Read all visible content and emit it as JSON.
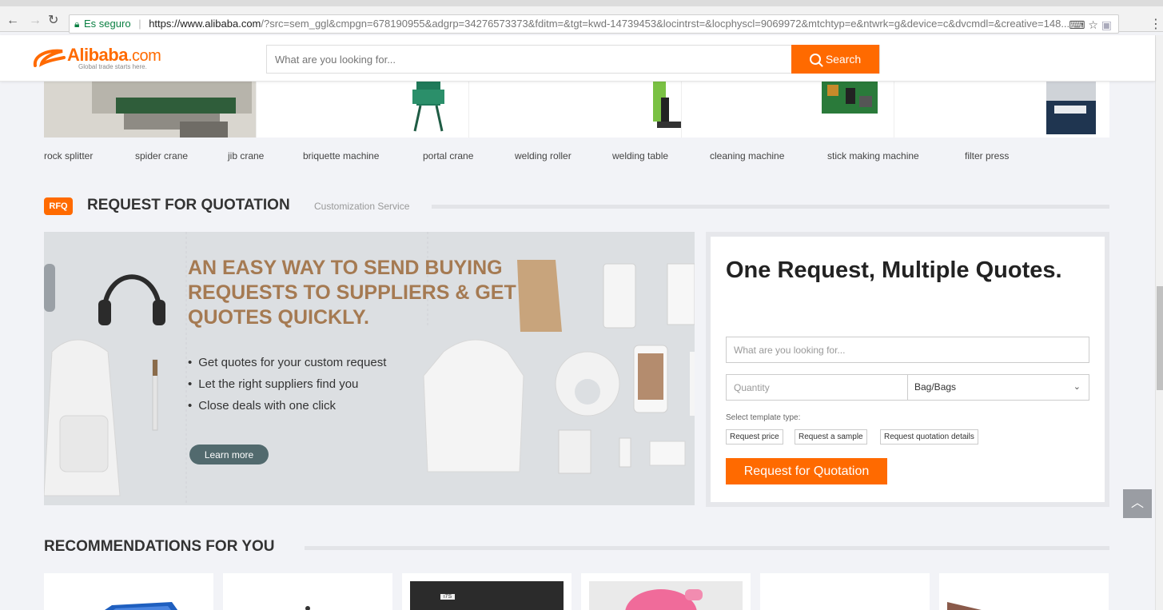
{
  "browser": {
    "secure_label": "Es seguro",
    "url_host": "https://www.alibaba.com",
    "url_rest": "/?src=sem_ggl&cmpgn=678190955&adgrp=34276573373&fditm=&tgt=kwd-14739453&locintrst=&locphyscl=9069972&mtchtyp=e&ntwrk=g&device=c&dvcmdl=&creative=148..."
  },
  "header": {
    "logo_text": "Alibaba",
    "logo_suffix": ".com",
    "logo_tagline": "Global trade starts here.",
    "search_placeholder": "What are you looking for...",
    "search_button": "Search"
  },
  "keywords": [
    "rock splitter",
    "spider crane",
    "jib crane",
    "briquette machine",
    "portal crane",
    "welding roller",
    "welding table",
    "cleaning machine",
    "stick making machine",
    "filter press"
  ],
  "rfq": {
    "badge": "RFQ",
    "title": "REQUEST FOR QUOTATION",
    "subtitle": "Customization Service",
    "banner": {
      "headline": "AN EASY WAY TO SEND BUYING REQUESTS TO SUPPLIERS & GET QUOTES QUICKLY.",
      "bullets": [
        "Get quotes for your custom request",
        "Let the right suppliers find you",
        "Close deals with one click"
      ],
      "learn_more": "Learn more"
    },
    "form": {
      "title": "One Request, Multiple Quotes.",
      "product_placeholder": "What are you looking for...",
      "quantity_placeholder": "Quantity",
      "unit_value": "Bag/Bags",
      "template_label": "Select template type:",
      "templates": [
        "Request price",
        "Request a sample",
        "Request quotation details"
      ],
      "submit": "Request for Quotation"
    }
  },
  "recommendations": {
    "title": "RECOMMENDATIONS FOR YOU",
    "thumb_text": "i7S"
  },
  "colors": {
    "accent": "#ff6a00",
    "banner_headline": "#a57a52",
    "learn_more_bg": "#526a6e",
    "page_bg": "#f2f3f7"
  }
}
